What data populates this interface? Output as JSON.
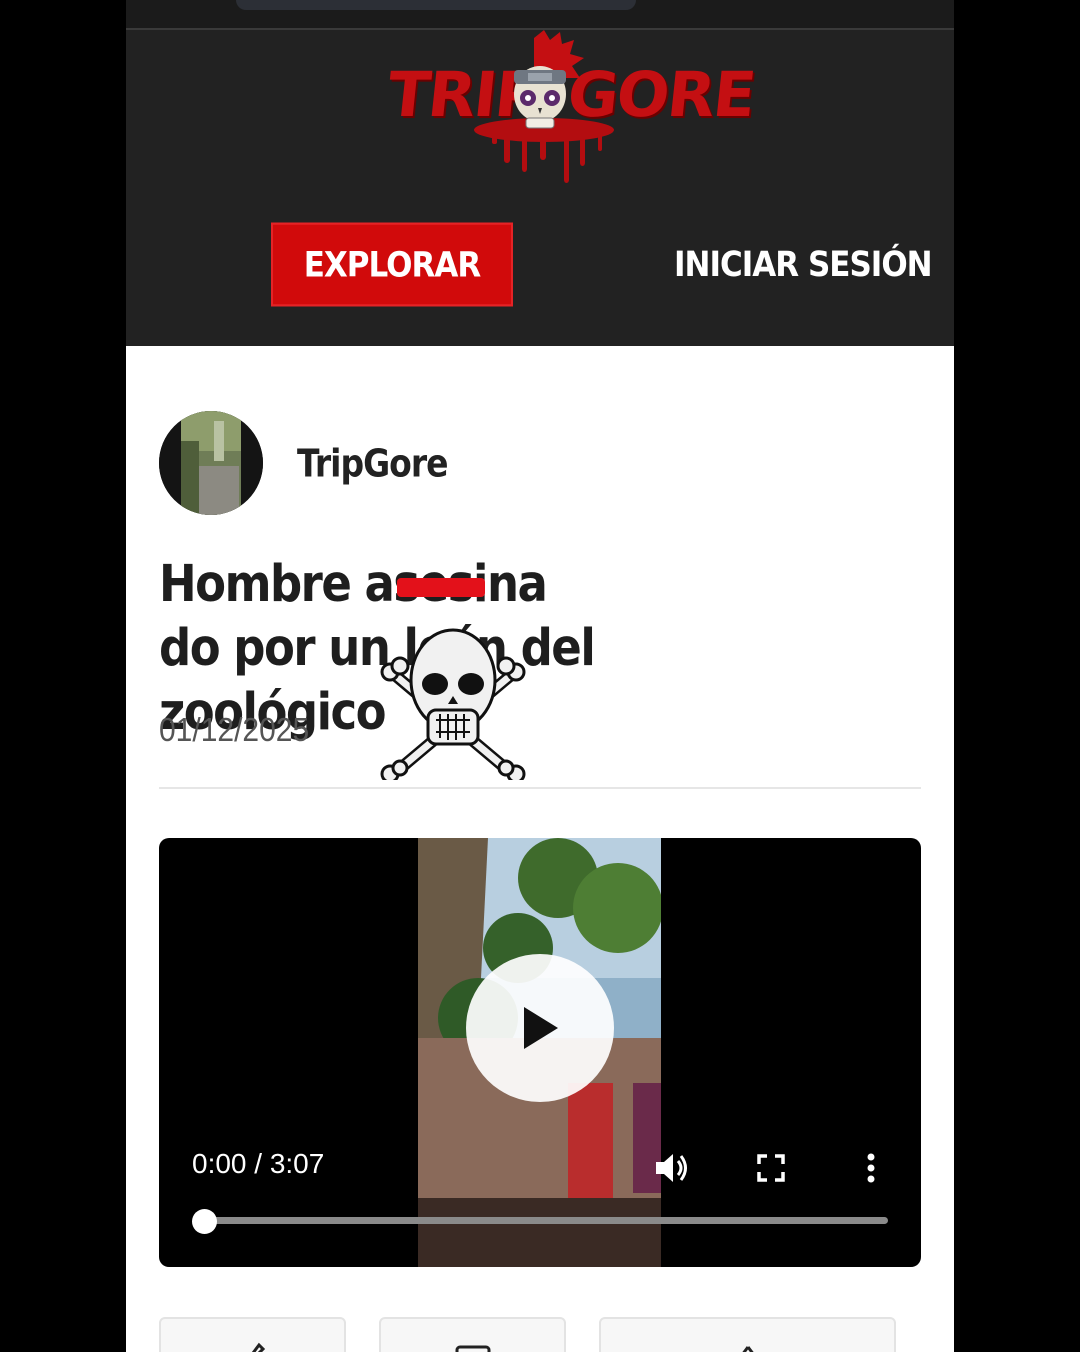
{
  "header": {
    "logo_left": "TRIP",
    "logo_right": "GORE",
    "explore_label": "EXPLORAR",
    "login_label": "INICIAR SESIÓN"
  },
  "article": {
    "author": "TripGore",
    "title_line1": "Hombre ase",
    "title_censored": "sina",
    "title_line1_rest": "do por un león del",
    "title_line2": "zoológico",
    "date": "01/12/2025"
  },
  "video": {
    "time": "0:00 / 3:07",
    "progress": 0.0
  },
  "icons": {
    "play": "play-icon",
    "volume": "volume-icon",
    "fullscreen": "fullscreen-icon",
    "more": "more-vertical-icon",
    "sticker": "skull-crossbones-icon"
  },
  "colors": {
    "brand_red": "#d10a0b",
    "header_bg": "#222222"
  }
}
